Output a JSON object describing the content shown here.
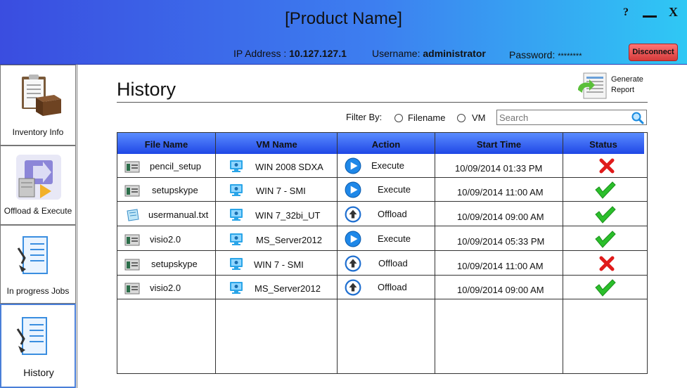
{
  "app": {
    "title": "[Product Name]",
    "help": "?",
    "close": "X"
  },
  "connection": {
    "ip_label": "IP Address : ",
    "ip_value": "10.127.127.1",
    "user_label": "Username: ",
    "user_value": "administrator",
    "pass_label": "Password: ",
    "pass_value": "********",
    "disconnect_label": "Disconnect"
  },
  "sidebar": {
    "items": [
      {
        "label": "Inventory Info",
        "icon": "clipboard-box-icon"
      },
      {
        "label": "Offload & Execute",
        "icon": "server-arrow-icon"
      },
      {
        "label": "In progress Jobs",
        "icon": "checklist-pen-icon"
      },
      {
        "label": "History",
        "icon": "checklist-pen-icon",
        "active": true
      }
    ]
  },
  "page": {
    "title": "History",
    "generate_report_line1": "Generate",
    "generate_report_line2": "Report",
    "filter_label": "Filter By:",
    "filter_options": [
      "Filename",
      "VM"
    ],
    "search_placeholder": "Search"
  },
  "table": {
    "columns": [
      "File Name",
      "VM Name",
      "Action",
      "Start Time",
      "Status"
    ],
    "rows": [
      {
        "file": "pencil_setup",
        "file_icon": "app-icon",
        "vm": "WIN 2008 SDXA",
        "action": "Execute",
        "action_icon": "play-icon",
        "start": "10/09/2014 01:33 PM",
        "status": "failed"
      },
      {
        "file": "setupskype",
        "file_icon": "app-icon",
        "vm": "WIN 7 - SMI",
        "action": "Execute",
        "action_icon": "play-icon",
        "start": "10/09/2014 11:00 AM",
        "status": "success"
      },
      {
        "file": "usermanual.txt",
        "file_icon": "text-file-icon",
        "vm": "WIN 7_32bi_UT",
        "action": "Offload",
        "action_icon": "upload-icon",
        "start": "10/09/2014 09:00 AM",
        "status": "success"
      },
      {
        "file": "visio2.0",
        "file_icon": "app-icon",
        "vm": "MS_Server2012",
        "action": "Execute",
        "action_icon": "play-icon",
        "start": "10/09/2014 05:33 PM",
        "status": "success"
      },
      {
        "file": "setupskype",
        "file_icon": "app-icon",
        "vm": "WIN 7 - SMI",
        "action": "Offload",
        "action_icon": "upload-icon",
        "start": "10/09/2014 11:00 AM",
        "status": "failed"
      },
      {
        "file": "visio2.0",
        "file_icon": "app-icon",
        "vm": "MS_Server2012",
        "action": "Offload",
        "action_icon": "upload-icon",
        "start": "10/09/2014 09:00 AM",
        "status": "success"
      }
    ]
  },
  "colors": {
    "header_start": "#3a4de0",
    "header_end": "#2fc8f4",
    "success": "#2bbf2b",
    "failed": "#e01a1a",
    "table_header": "#2f5cf0"
  }
}
